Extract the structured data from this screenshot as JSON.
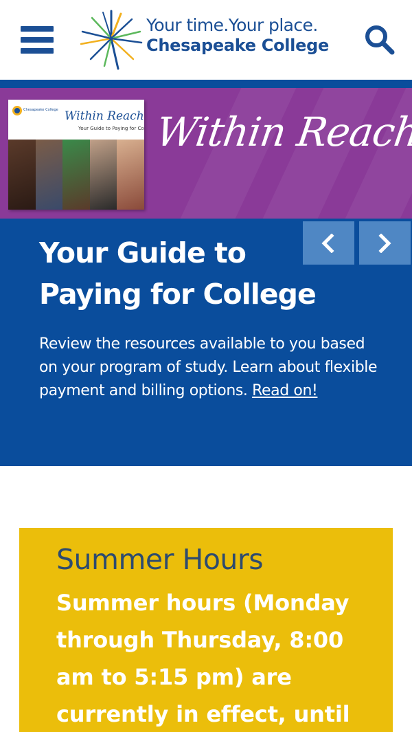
{
  "header": {
    "tagline": "Your time.Your place.",
    "college_name": "Chesapeake College",
    "menu_icon": "hamburger-menu-icon",
    "search_icon": "search-icon",
    "brand_color": "#1b4f95"
  },
  "banner": {
    "script_title": "Within Reach",
    "booklet_title": "Within Reach",
    "booklet_subtitle": "Your Guide to Paying for College",
    "booklet_small": "Chesapeake College",
    "background_color": "#8a3a98"
  },
  "hero": {
    "heading": "Your Guide to Paying for College",
    "body": "Review the resources available to you based on your program of study. Learn about flexible payment and billing options. ",
    "link": "Read on!",
    "background_color": "#0a4d9c",
    "prev_icon": "chevron-left-icon",
    "next_icon": "chevron-right-icon"
  },
  "summer": {
    "title": "Summer Hours",
    "body": "Summer hours (Monday through Thursday, 8:00 am to 5:15 pm) are currently in effect, until",
    "background_color": "#ebbe0b"
  }
}
